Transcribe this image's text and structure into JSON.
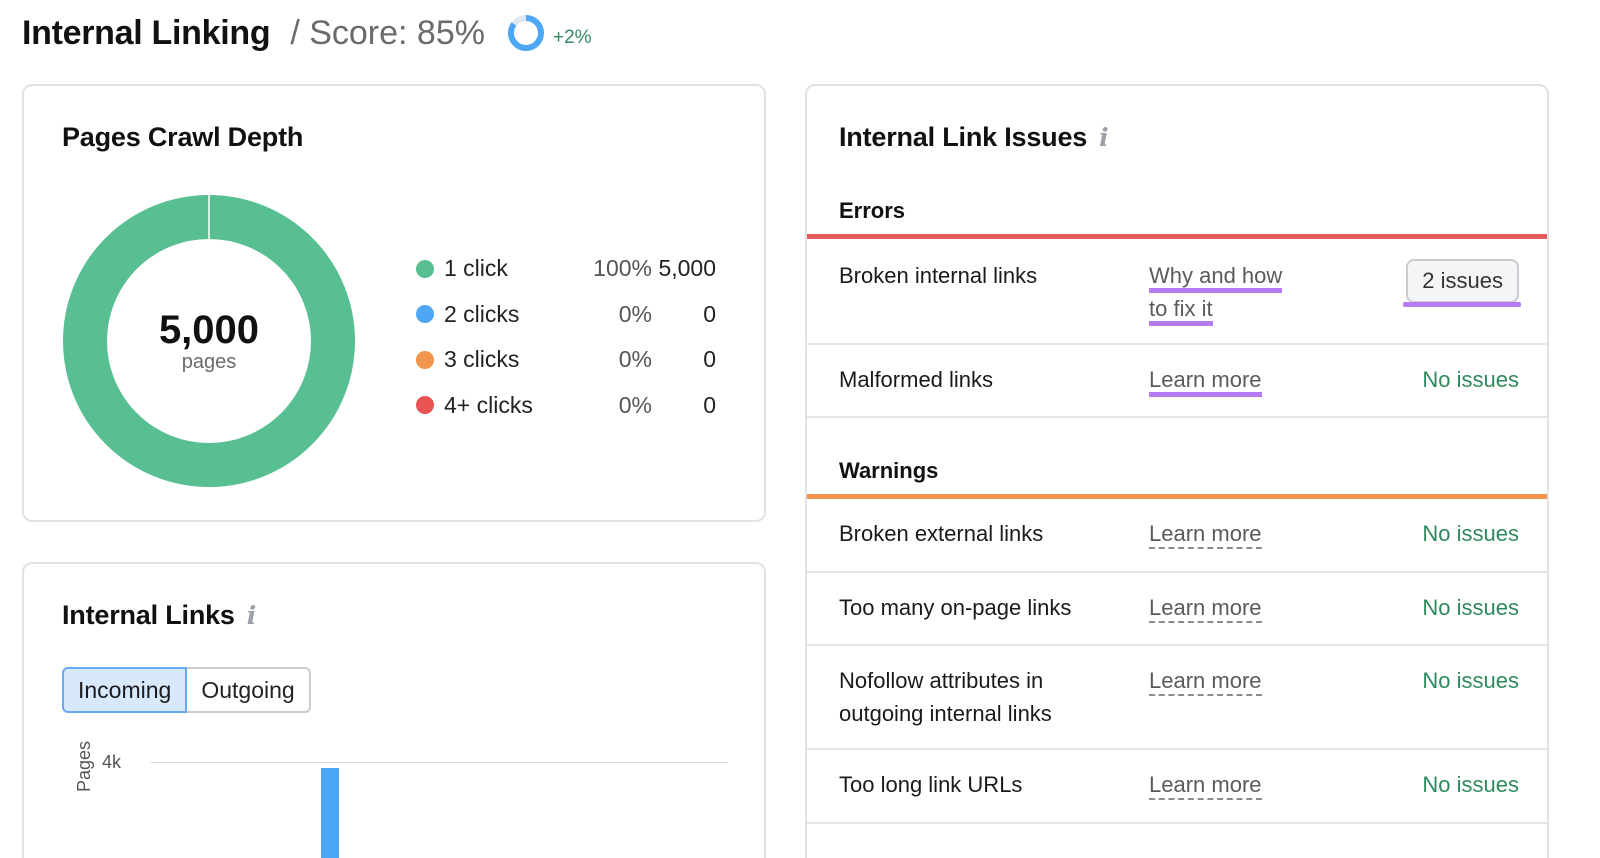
{
  "header": {
    "title": "Internal Linking",
    "score_label": "/ Score: 85%",
    "score_delta": "+2%"
  },
  "crawl_depth": {
    "title": "Pages Crawl Depth",
    "total_value": "5,000",
    "total_caption": "pages",
    "legend": [
      {
        "label": "1 click",
        "percent": "100%",
        "count": "5,000",
        "color": "#57bf92"
      },
      {
        "label": "2 clicks",
        "percent": "0%",
        "count": "0",
        "color": "#4ea7f4"
      },
      {
        "label": "3 clicks",
        "percent": "0%",
        "count": "0",
        "color": "#f1944d"
      },
      {
        "label": "4+ clicks",
        "percent": "0%",
        "count": "0",
        "color": "#ea5353"
      }
    ]
  },
  "internal_links": {
    "title": "Internal Links",
    "tabs": [
      "Incoming",
      "Outgoing"
    ],
    "active_tab": "Incoming",
    "y_tick": "4k",
    "y_label": "Pages"
  },
  "issues": {
    "title": "Internal Link Issues",
    "errors_label": "Errors",
    "warnings_label": "Warnings",
    "errors": [
      {
        "name": "Broken internal links",
        "link_line1": "Why and how",
        "link_line2": "to fix it",
        "badge": "2 issues"
      },
      {
        "name": "Malformed links",
        "link": "Learn more",
        "status": "No issues"
      }
    ],
    "warnings": [
      {
        "name": "Broken external links",
        "link": "Learn more",
        "status": "No issues"
      },
      {
        "name": "Too many on-page links",
        "link": "Learn more",
        "status": "No issues"
      },
      {
        "name_line1": "Nofollow attributes in",
        "name_line2": "outgoing internal links",
        "link": "Learn more",
        "status": "No issues"
      },
      {
        "name": "Too long link URLs",
        "link": "Learn more",
        "status": "No issues"
      }
    ]
  },
  "colors": {
    "error_line": "#e35b5b",
    "warning_line": "#f1944d",
    "highlight": "#b57bf4",
    "success": "#2f8a5b",
    "score_ring": "#4ea7f4"
  },
  "icons": [
    "info-icon",
    "score-ring-icon"
  ]
}
